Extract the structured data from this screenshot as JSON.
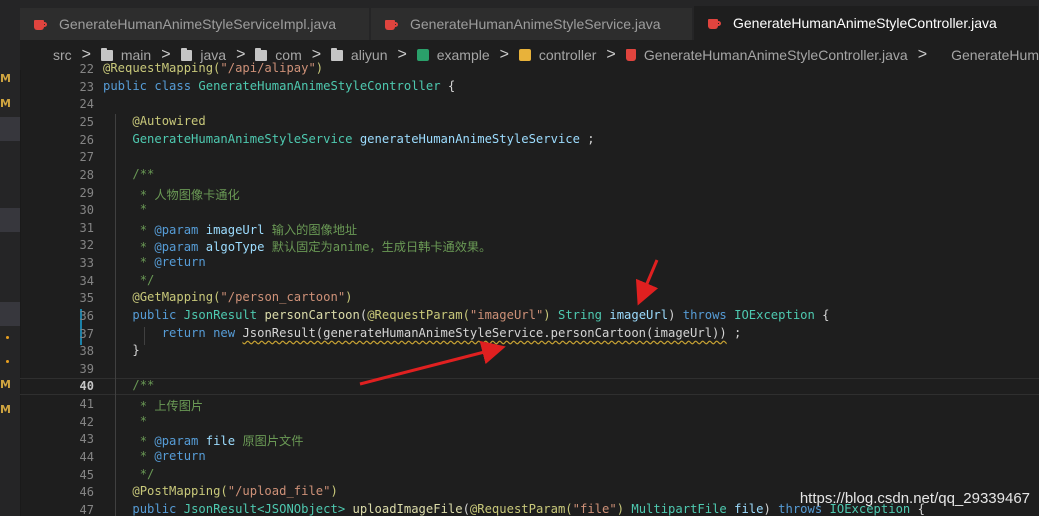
{
  "tabs": [
    {
      "label": "GenerateHumanAnimeStyleServiceImpl.java",
      "active": false
    },
    {
      "label": "GenerateHumanAnimeStyleService.java",
      "active": false
    },
    {
      "label": "GenerateHumanAnimeStyleController.java",
      "active": true
    }
  ],
  "breadcrumb": {
    "items": [
      "src",
      "main",
      "java",
      "com",
      "aliyun",
      "example",
      "controller",
      "GenerateHumanAnimeStyleController.java",
      "GenerateHum"
    ],
    "separator": ">"
  },
  "left_gutter": {
    "letters": [
      "M",
      "M",
      "M",
      "M"
    ]
  },
  "editor": {
    "current_line": 40,
    "line_numbers": [
      22,
      23,
      24,
      25,
      26,
      27,
      28,
      29,
      30,
      31,
      32,
      33,
      34,
      35,
      36,
      37,
      38,
      39,
      40,
      41,
      42,
      43,
      44,
      45,
      46,
      47
    ],
    "code": {
      "l22": {
        "anno": "@RequestMapping(",
        "str": "\"/api/alipay\"",
        "rest": ")"
      },
      "l23": {
        "kw1": "public",
        "kw2": "class",
        "name": "GenerateHumanAnimeStyleController",
        "rest": " {"
      },
      "l25": {
        "anno": "@Autowired"
      },
      "l26": {
        "type": "GenerateHumanAnimeStyleService",
        "field": "generateHumanAnimeStyleService",
        "rest": " ;"
      },
      "l28": {
        "cm": "/**"
      },
      "l29": {
        "cm": " * 人物图像卡通化"
      },
      "l30": {
        "cm": " *"
      },
      "l31": {
        "cm1": " * ",
        "tag": "@param",
        "param": "imageUrl",
        "cm2": " 输入的图像地址"
      },
      "l32": {
        "cm1": " * ",
        "tag": "@param",
        "param": "algoType",
        "cm2": " 默认固定为anime，生成日韩卡通效果。"
      },
      "l33": {
        "cm1": " * ",
        "tag": "@return"
      },
      "l34": {
        "cm": " */"
      },
      "l35": {
        "anno": "@GetMapping(",
        "str": "\"/person_cartoon\"",
        "rest": ")"
      },
      "l36": {
        "kw": "public",
        "type": "JsonResult",
        "fn": "personCartoon",
        "p1": "(",
        "anno": "@RequestParam(",
        "str": "\"imageUrl\"",
        "p2": ") ",
        "type2": "String",
        "param": "imageUrl",
        "p3": ") ",
        "kw2": "throws",
        "exc": "IOException",
        "rest": " {"
      },
      "l37": {
        "kw": "return",
        "kw2": "new",
        "call": "JsonResult(generateHumanAnimeStyleService.personCartoon(imageUrl))",
        "rest": " ;"
      },
      "l38": {
        "text": "}"
      },
      "l40": {
        "cm": "/**"
      },
      "l41": {
        "cm": " * 上传图片"
      },
      "l42": {
        "cm": " *"
      },
      "l43": {
        "cm1": " * ",
        "tag": "@param",
        "param": "file",
        "cm2": " 原图片文件"
      },
      "l44": {
        "cm1": " * ",
        "tag": "@return"
      },
      "l45": {
        "cm": " */"
      },
      "l46": {
        "anno": "@PostMapping(",
        "str": "\"/upload_file\"",
        "rest": ")"
      },
      "l47": {
        "kw": "public",
        "type": "JsonResult<JSONObject>",
        "fn": "uploadImageFile",
        "p1": "(",
        "anno": "@RequestParam(",
        "str": "\"file\"",
        "p2": ") ",
        "type2": "MultipartFile",
        "param": "file",
        "p3": ") ",
        "kw2": "throws",
        "exc": "IOException",
        "rest": " {"
      }
    }
  },
  "watermark": "https://blog.csdn.net/qq_29339467",
  "colors": {
    "background": "#1e1e1e",
    "keyword": "#569cd6",
    "type": "#4ec9b0",
    "string": "#ce9178",
    "comment": "#6a9955",
    "annotation_arrow": "#e02020"
  }
}
